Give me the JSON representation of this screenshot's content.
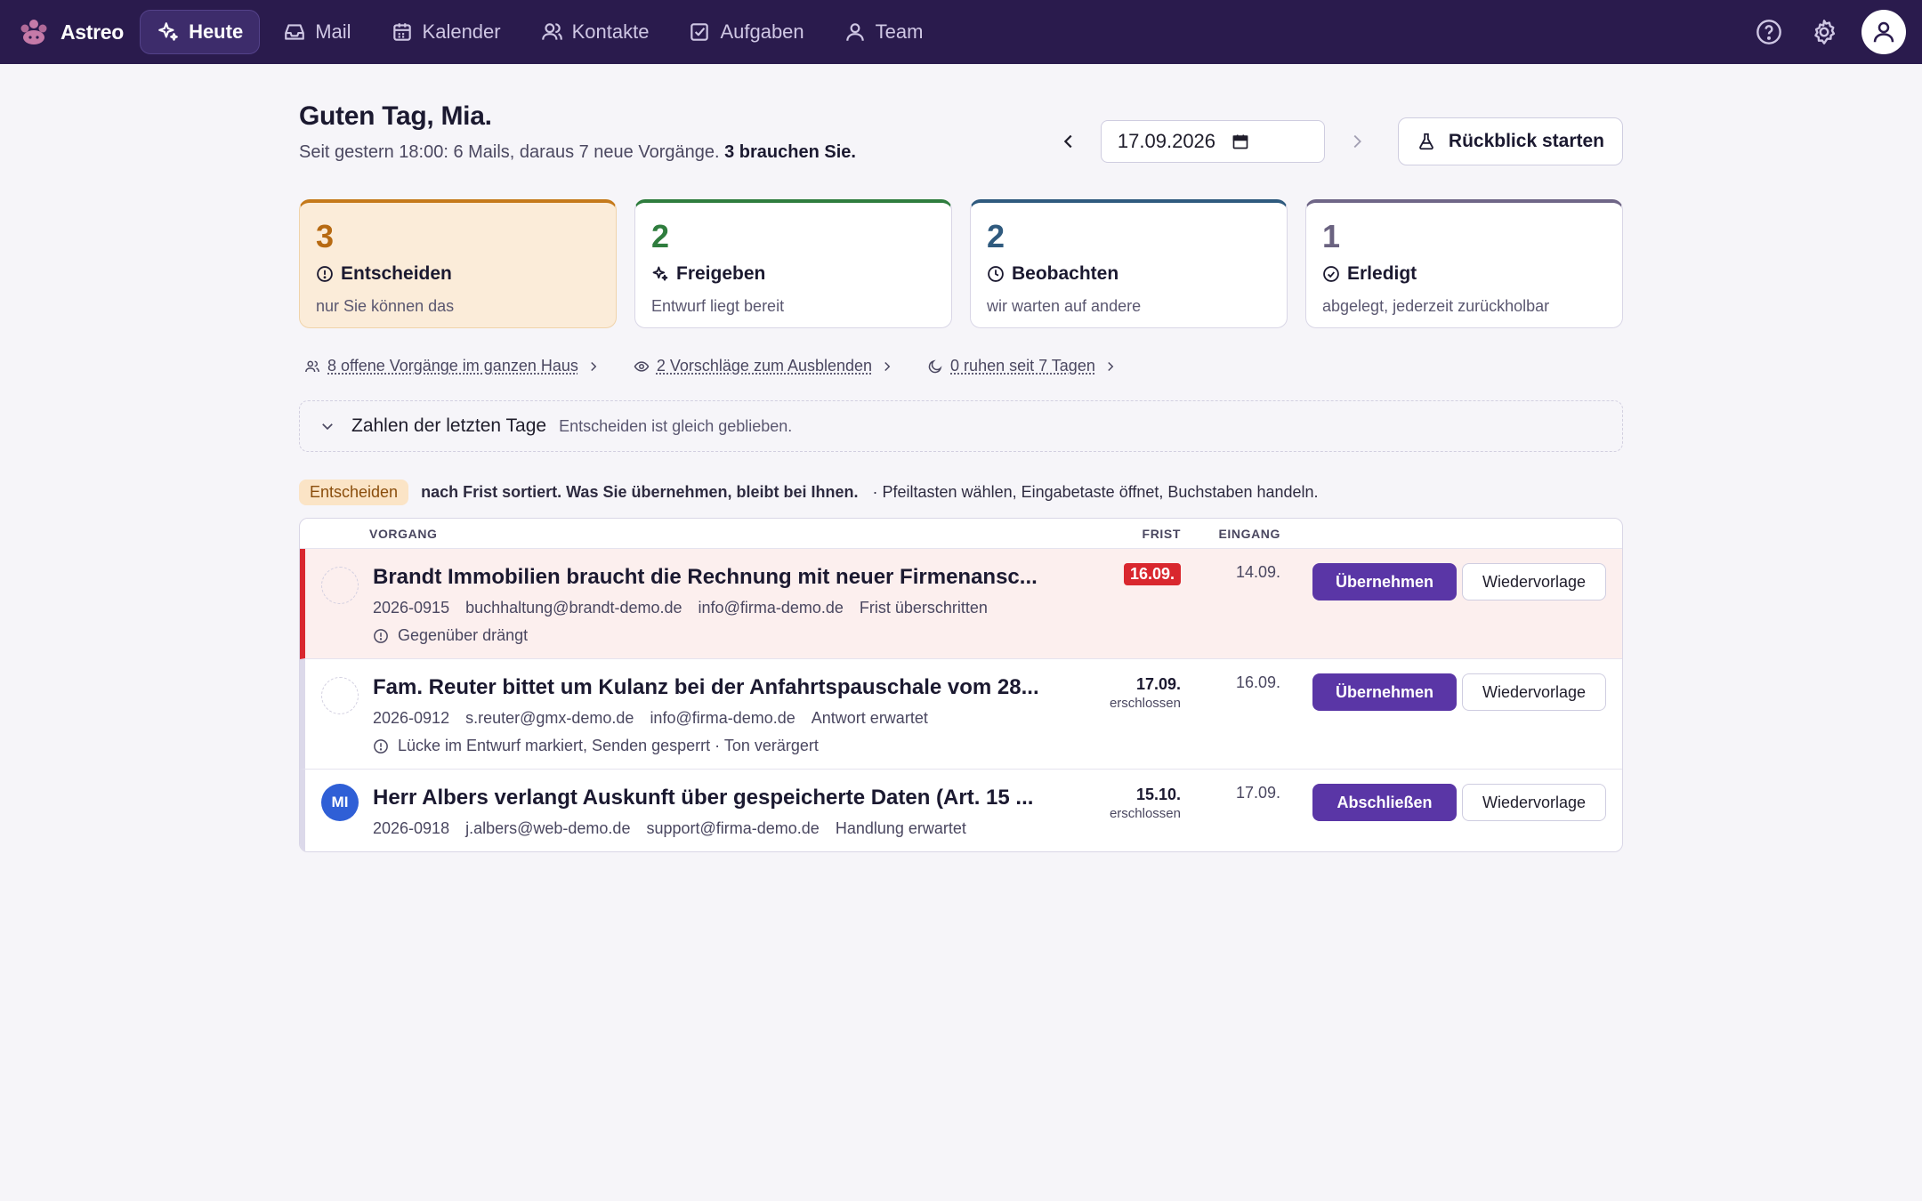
{
  "app": {
    "name": "Astreo"
  },
  "nav": {
    "items": [
      {
        "label": "Heute",
        "icon": "sparkle-icon",
        "active": true
      },
      {
        "label": "Mail",
        "icon": "inbox-icon"
      },
      {
        "label": "Kalender",
        "icon": "calendar-icon"
      },
      {
        "label": "Kontakte",
        "icon": "contacts-icon"
      },
      {
        "label": "Aufgaben",
        "icon": "checkbox-icon"
      },
      {
        "label": "Team",
        "icon": "user-icon"
      }
    ]
  },
  "header": {
    "title": "Guten Tag, Mia.",
    "subtitle": "Seit gestern 18:00: 6 Mails, daraus 7 neue Vorgänge.",
    "subtitle_strong": "3 brauchen Sie.",
    "date": "17.09.2026",
    "retro_label": "Rückblick starten"
  },
  "cards": [
    {
      "count": "3",
      "title": "Entscheiden",
      "desc": "nur Sie können das",
      "icon": "alert-circle-icon"
    },
    {
      "count": "2",
      "title": "Freigeben",
      "desc": "Entwurf liegt bereit",
      "icon": "sparkle-icon"
    },
    {
      "count": "2",
      "title": "Beobachten",
      "desc": "wir warten auf andere",
      "icon": "clock-icon"
    },
    {
      "count": "1",
      "title": "Erledigt",
      "desc": "abgelegt, jederzeit zurückholbar",
      "icon": "check-circle-icon"
    }
  ],
  "quick_links": [
    {
      "label": "8 offene Vorgänge im ganzen Haus",
      "icon": "users-icon"
    },
    {
      "label": "2 Vorschläge zum Ausblenden",
      "icon": "eye-icon"
    },
    {
      "label": "0 ruhen seit 7 Tagen",
      "icon": "moon-icon"
    }
  ],
  "numbers": {
    "label": "Zahlen der letzten Tage",
    "hint": "Entscheiden ist gleich geblieben."
  },
  "sort": {
    "pill": "Entscheiden",
    "text": "nach Frist sortiert. Was Sie übernehmen, bleibt bei Ihnen.",
    "hint": "· Pfeiltasten wählen, Eingabetaste öffnet, Buchstaben handeln."
  },
  "table": {
    "headers": {
      "vorgang": "VORGANG",
      "frist": "FRIST",
      "eingang": "EINGANG"
    },
    "rows": [
      {
        "subject": "Brandt Immobilien braucht die Rechnung mit neuer Firmenansc...",
        "id": "2026-0915",
        "from": "buchhaltung@brandt-demo.de",
        "to": "info@firma-demo.de",
        "status": "Frist überschritten",
        "note": "Gegenüber drängt",
        "frist": "16.09.",
        "frist_sub": "",
        "eingang": "14.09.",
        "primary": "Übernehmen",
        "secondary": "Wiedervorlage"
      },
      {
        "subject": "Fam. Reuter bittet um Kulanz bei der Anfahrtspauschale vom 28...",
        "id": "2026-0912",
        "from": "s.reuter@gmx-demo.de",
        "to": "info@firma-demo.de",
        "status": "Antwort erwartet",
        "note": "Lücke im Entwurf markiert, Senden gesperrt · Ton verärgert",
        "frist": "17.09.",
        "frist_sub": "erschlossen",
        "eingang": "16.09.",
        "primary": "Übernehmen",
        "secondary": "Wiedervorlage"
      },
      {
        "subject": "Herr Albers verlangt Auskunft über gespeicherte Daten (Art. 15 ...",
        "id": "2026-0918",
        "from": "j.albers@web-demo.de",
        "to": "support@firma-demo.de",
        "status": "Handlung erwartet",
        "avatar": "MI",
        "frist": "15.10.",
        "frist_sub": "erschlossen",
        "eingang": "17.09.",
        "primary": "Abschließen",
        "secondary": "Wiedervorlage"
      }
    ]
  },
  "colors": {
    "nav_bg": "#2a1b4d",
    "accent": "#5a36a6",
    "decide": "#c57a1b",
    "release": "#2f7d3e",
    "observe": "#2f5a7e",
    "done": "#6f6687",
    "overdue": "#d9272e"
  }
}
